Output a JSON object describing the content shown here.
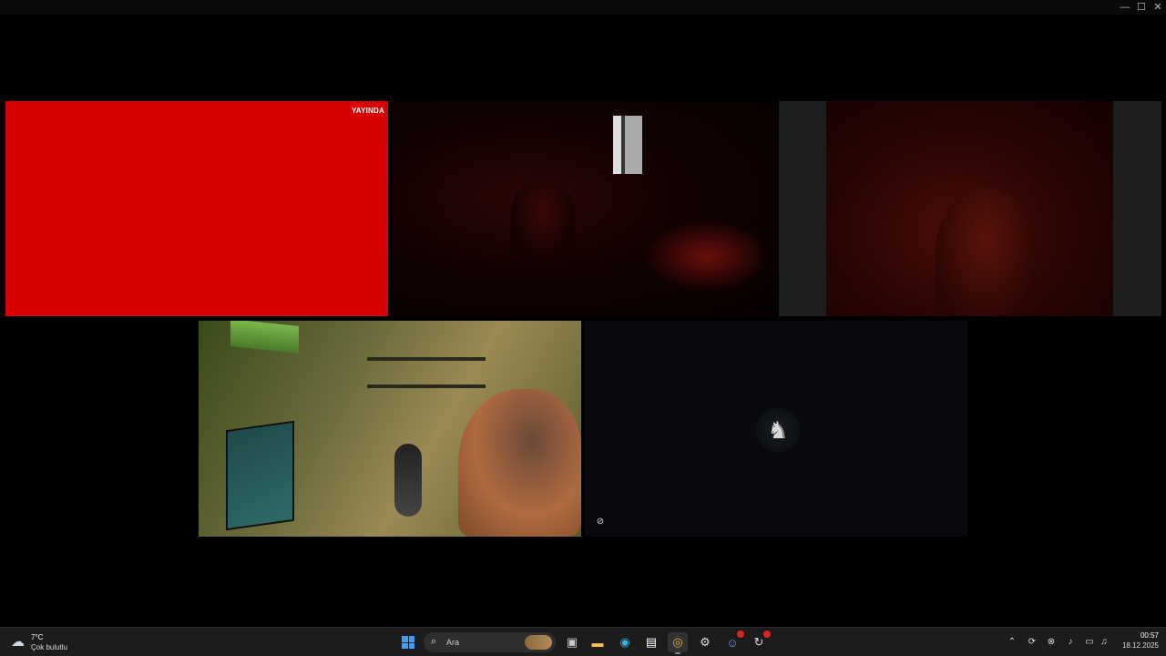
{
  "window": {
    "minimize_glyph": "—",
    "maximize_glyph": "☐",
    "close_glyph": "✕"
  },
  "tiles": [
    {
      "id": "tile-1",
      "badge": "YAYINDA",
      "color": "#d90000"
    },
    {
      "id": "tile-2"
    },
    {
      "id": "tile-3"
    },
    {
      "id": "tile-4"
    },
    {
      "id": "tile-5",
      "avatar_icon": "warrior-avatar-icon"
    }
  ],
  "taskbar": {
    "weather": {
      "temperature": "7°C",
      "description": "Çok bulutlu",
      "icon": "cloud-sun-icon"
    },
    "search": {
      "placeholder": "Ara"
    },
    "pinned_apps": [
      {
        "name": "start",
        "icon": "windows-logo-icon"
      },
      {
        "name": "task-view",
        "icon": "task-view-icon"
      },
      {
        "name": "file-explorer",
        "icon": "folder-icon"
      },
      {
        "name": "edge",
        "icon": "edge-icon"
      },
      {
        "name": "store",
        "icon": "store-icon"
      },
      {
        "name": "chrome",
        "icon": "chrome-icon",
        "active": true
      },
      {
        "name": "steam",
        "icon": "steam-icon"
      },
      {
        "name": "discord",
        "icon": "discord-icon"
      },
      {
        "name": "app",
        "icon": "app-icon"
      }
    ],
    "tray": {
      "chevron": "⌃",
      "clock_time": "00:57",
      "clock_date": "18.12.2025"
    }
  },
  "colors": {
    "live": "#d90000",
    "taskbar": "#1c1c1c",
    "accent": "#3aa0ff"
  }
}
